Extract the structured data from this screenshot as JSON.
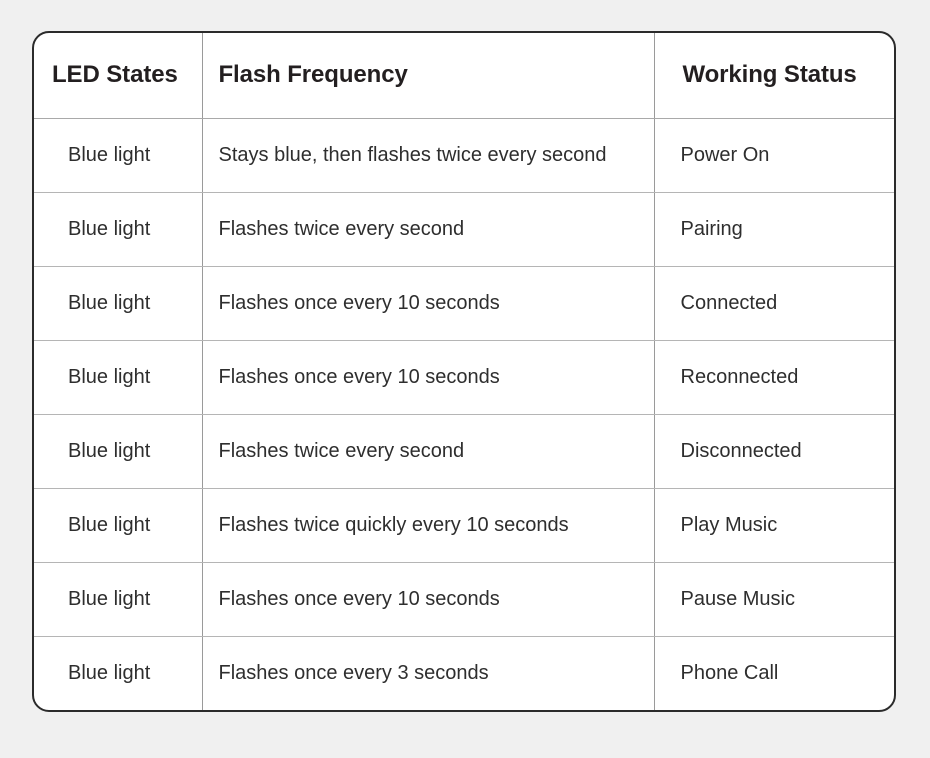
{
  "table": {
    "columns": [
      {
        "key": "led_states",
        "label": "LED States"
      },
      {
        "key": "flash_frequency",
        "label": "Flash Frequency"
      },
      {
        "key": "working_status",
        "label": "Working Status"
      }
    ],
    "rows": [
      {
        "led_states": "Blue light",
        "flash_frequency": "Stays blue, then flashes twice every second",
        "working_status": "Power On"
      },
      {
        "led_states": "Blue light",
        "flash_frequency": "Flashes twice every second",
        "working_status": "Pairing"
      },
      {
        "led_states": "Blue light",
        "flash_frequency": "Flashes once every 10 seconds",
        "working_status": "Connected"
      },
      {
        "led_states": "Blue light",
        "flash_frequency": "Flashes once every 10 seconds",
        "working_status": "Reconnected"
      },
      {
        "led_states": "Blue light",
        "flash_frequency": "Flashes twice every second",
        "working_status": "Disconnected"
      },
      {
        "led_states": "Blue light",
        "flash_frequency": "Flashes twice quickly every 10 seconds",
        "working_status": "Play Music"
      },
      {
        "led_states": "Blue light",
        "flash_frequency": "Flashes once every 10 seconds",
        "working_status": "Pause Music"
      },
      {
        "led_states": "Blue light",
        "flash_frequency": "Flashes once every 3 seconds",
        "working_status": "Phone Call"
      }
    ]
  },
  "colors": {
    "page_background": "#f0f0f0",
    "card_background": "#ffffff",
    "card_border": "#2b2b2b",
    "grid_line": "#b5b5b5",
    "header_text": "#231f20",
    "body_text": "#2e2e2e"
  }
}
